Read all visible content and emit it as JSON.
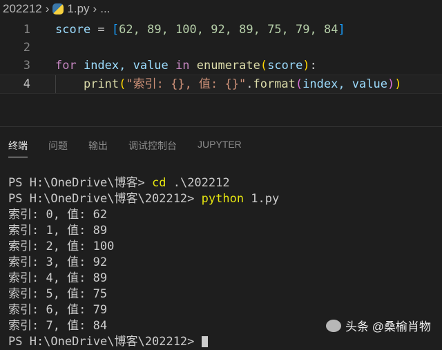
{
  "breadcrumb": {
    "folder": "202212",
    "file": "1.py",
    "more": "..."
  },
  "code": {
    "l1": {
      "num": "1",
      "var": "score",
      "op": " = ",
      "open": "[",
      "nums": "62, 89, 100, 92, 89, 75, 79, 84",
      "close": "]"
    },
    "l2": {
      "num": "2"
    },
    "l3": {
      "num": "3",
      "kw": "for",
      "a": " index, value ",
      "in": "in",
      "sp": " ",
      "fn": "enumerate",
      "open": "(",
      "arg": "score",
      "close": ")",
      "colon": ":"
    },
    "l4": {
      "num": "4",
      "indent": "    ",
      "fn": "print",
      "open": "(",
      "str": "\"索引: {}, 值: {}\"",
      "dot": ".",
      "fn2": "format",
      "open2": "(",
      "args": "index, value",
      "close2": ")",
      "close": ")"
    }
  },
  "panel": {
    "tabs": [
      "终端",
      "问题",
      "输出",
      "调试控制台",
      "JUPYTER"
    ]
  },
  "terminal": {
    "p1": "PS H:\\OneDrive\\博客> ",
    "c1": "cd",
    " a1": "",
    "a1": " .\\202212",
    "p2": "PS H:\\OneDrive\\博客\\202212> ",
    "c2": "python",
    "a2": " 1.py",
    "out": [
      "索引: 0, 值: 62",
      "索引: 1, 值: 89",
      "索引: 2, 值: 100",
      "索引: 3, 值: 92",
      "索引: 4, 值: 89",
      "索引: 5, 值: 75",
      "索引: 6, 值: 79",
      "索引: 7, 值: 84"
    ],
    "p3": "PS H:\\OneDrive\\博客\\202212> "
  },
  "watermark": "头条 @桑榆肖物"
}
